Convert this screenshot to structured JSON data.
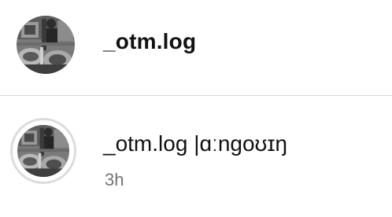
{
  "account": {
    "username": "_otm.log"
  },
  "post": {
    "username": "_otm.log",
    "caption": "|ɑːngoʊɪŋ",
    "timestamp": "3h"
  }
}
